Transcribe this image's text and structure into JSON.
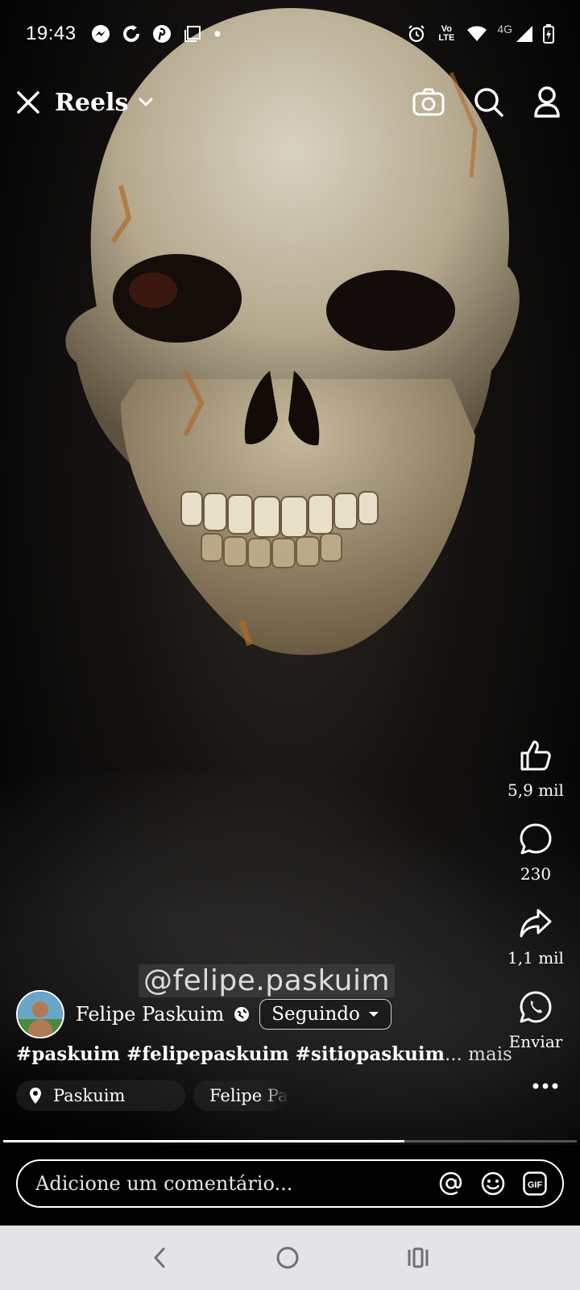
{
  "status_bar": {
    "time": "19:43",
    "left_icons": [
      "messenger-icon",
      "sync-icon",
      "pinterest-icon",
      "screenshot-icon",
      "dot-icon"
    ],
    "right_icons": [
      "alarm-icon",
      "volte-icon",
      "wifi-icon",
      "signal-icon",
      "battery-icon"
    ],
    "network_label": "4G",
    "volte_label": "Vo LTE"
  },
  "header": {
    "title": "Reels",
    "close_icon": "close-icon",
    "dropdown_icon": "chevron-down-icon",
    "actions": [
      "camera-icon",
      "search-icon",
      "profile-icon"
    ]
  },
  "actions": {
    "like_count": "5,9 mil",
    "comment_count": "230",
    "share_count": "1,1 mil",
    "whatsapp_label": "Enviar"
  },
  "post": {
    "author": "Felipe Paskuim",
    "follow_label": "Seguindo",
    "watermark": "@felipe.paskuim",
    "caption_tags": "#paskuim #felipepaskuim #sitiopaskuim",
    "caption_more": "... mais",
    "location": "Paskuim",
    "audio": "Felipe Paskuim"
  },
  "progress": 0.7,
  "comment": {
    "placeholder": "Adicione um comentário...",
    "icons": [
      "mention-icon",
      "emoji-icon",
      "gif-icon"
    ]
  },
  "nav": [
    "back-icon",
    "home-icon",
    "recents-icon"
  ],
  "colors": {
    "background": "#000000",
    "text": "#ffffff",
    "nav_bar": "#e4e4e8",
    "nav_icon": "#707070"
  }
}
